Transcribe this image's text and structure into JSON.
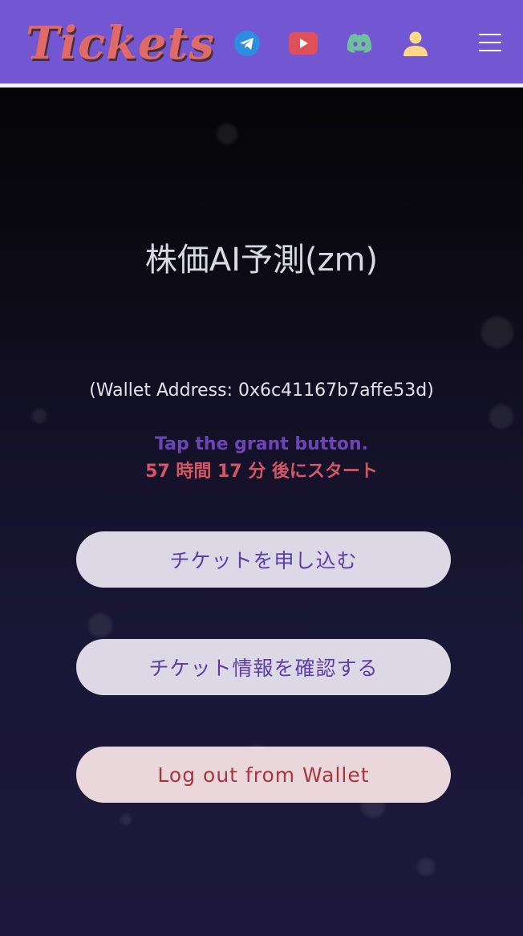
{
  "header": {
    "logo": "Tickets",
    "icons": [
      "telegram-icon",
      "youtube-icon",
      "discord-icon",
      "user-icon",
      "menu-icon"
    ]
  },
  "main": {
    "title": "株価AI予測(zm)",
    "wallet_address": "(Wallet Address: 0x6c41167b7affe53d)",
    "instruction": "Tap the grant button.",
    "countdown": "57 時間 17 分 後にスタート"
  },
  "buttons": {
    "apply_label": "チケットを申し込む",
    "confirm_label": "チケット情報を確認する",
    "logout_label": "Log out from Wallet"
  },
  "colors": {
    "header_bg": "#7356d1",
    "logo": "#e06a68",
    "instruction": "#6b45b8",
    "countdown": "#d65666",
    "button_bg": "#dcd8e6",
    "logout_text": "#a8363f"
  }
}
